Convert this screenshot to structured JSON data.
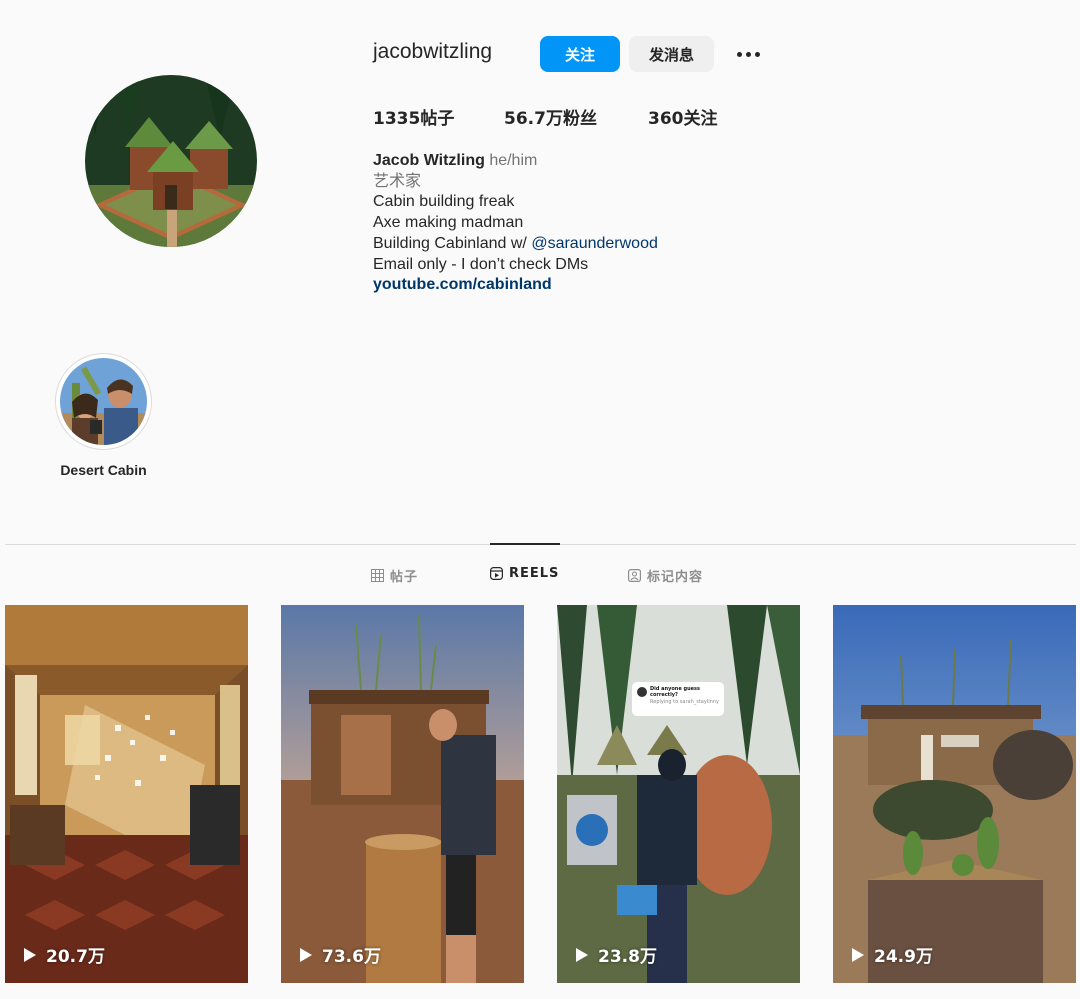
{
  "profile": {
    "username": "jacobwitzling",
    "follow_label": "关注",
    "message_label": "发消息",
    "more_icon": "more-horizontal-icon"
  },
  "stats": {
    "posts": "1335帖子",
    "followers": "56.7万粉丝",
    "following": "360关注"
  },
  "bio": {
    "name": "Jacob Witzling",
    "pronouns": "he/him",
    "category": "艺术家",
    "line1": "Cabin building freak",
    "line2": "Axe making madman",
    "line3_prefix": "Building Cabinland w/ ",
    "line3_mention": "@saraunderwood",
    "line4": "Email only - I don’t check DMs",
    "link": "youtube.com/cabinland"
  },
  "highlights": [
    {
      "label": "Desert Cabin"
    }
  ],
  "tabs": [
    {
      "label": "帖子",
      "icon": "grid-icon",
      "active": false
    },
    {
      "label": "REELS",
      "icon": "reels-icon",
      "active": true
    },
    {
      "label": "标记内容",
      "icon": "tagged-icon",
      "active": false
    }
  ],
  "reels": [
    {
      "views": "20.7万"
    },
    {
      "views": "73.6万"
    },
    {
      "views": "23.8万"
    },
    {
      "views": "24.9万"
    }
  ],
  "overlay": {
    "question": "Did anyone guess correctly?",
    "reply": "Replying to sarah_staylinny"
  },
  "colors": {
    "accent": "#0095f6",
    "link": "#00376b",
    "background": "#fafafa"
  }
}
